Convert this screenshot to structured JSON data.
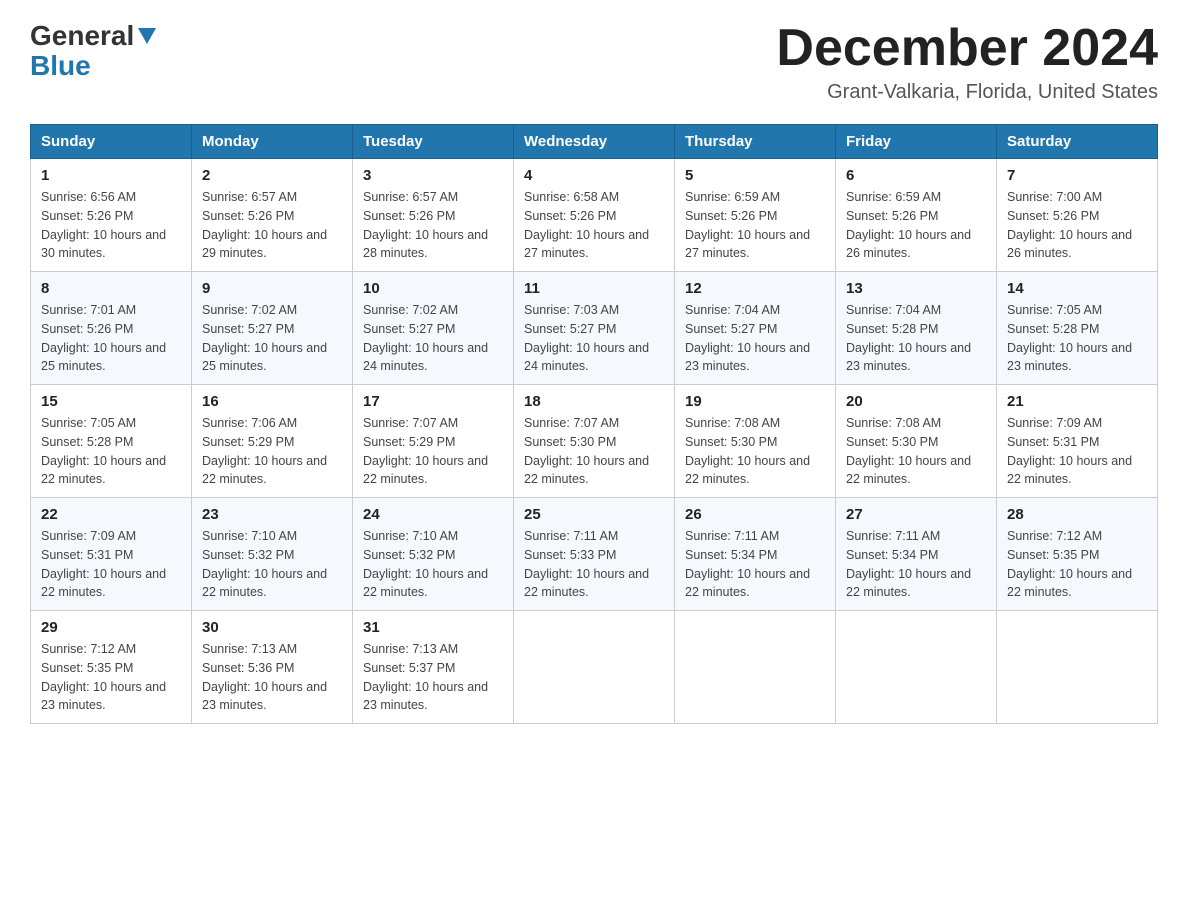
{
  "header": {
    "logo_general": "General",
    "logo_blue": "Blue",
    "month_year": "December 2024",
    "location": "Grant-Valkaria, Florida, United States"
  },
  "days_of_week": [
    "Sunday",
    "Monday",
    "Tuesday",
    "Wednesday",
    "Thursday",
    "Friday",
    "Saturday"
  ],
  "weeks": [
    [
      {
        "day": "1",
        "sunrise": "Sunrise: 6:56 AM",
        "sunset": "Sunset: 5:26 PM",
        "daylight": "Daylight: 10 hours and 30 minutes."
      },
      {
        "day": "2",
        "sunrise": "Sunrise: 6:57 AM",
        "sunset": "Sunset: 5:26 PM",
        "daylight": "Daylight: 10 hours and 29 minutes."
      },
      {
        "day": "3",
        "sunrise": "Sunrise: 6:57 AM",
        "sunset": "Sunset: 5:26 PM",
        "daylight": "Daylight: 10 hours and 28 minutes."
      },
      {
        "day": "4",
        "sunrise": "Sunrise: 6:58 AM",
        "sunset": "Sunset: 5:26 PM",
        "daylight": "Daylight: 10 hours and 27 minutes."
      },
      {
        "day": "5",
        "sunrise": "Sunrise: 6:59 AM",
        "sunset": "Sunset: 5:26 PM",
        "daylight": "Daylight: 10 hours and 27 minutes."
      },
      {
        "day": "6",
        "sunrise": "Sunrise: 6:59 AM",
        "sunset": "Sunset: 5:26 PM",
        "daylight": "Daylight: 10 hours and 26 minutes."
      },
      {
        "day": "7",
        "sunrise": "Sunrise: 7:00 AM",
        "sunset": "Sunset: 5:26 PM",
        "daylight": "Daylight: 10 hours and 26 minutes."
      }
    ],
    [
      {
        "day": "8",
        "sunrise": "Sunrise: 7:01 AM",
        "sunset": "Sunset: 5:26 PM",
        "daylight": "Daylight: 10 hours and 25 minutes."
      },
      {
        "day": "9",
        "sunrise": "Sunrise: 7:02 AM",
        "sunset": "Sunset: 5:27 PM",
        "daylight": "Daylight: 10 hours and 25 minutes."
      },
      {
        "day": "10",
        "sunrise": "Sunrise: 7:02 AM",
        "sunset": "Sunset: 5:27 PM",
        "daylight": "Daylight: 10 hours and 24 minutes."
      },
      {
        "day": "11",
        "sunrise": "Sunrise: 7:03 AM",
        "sunset": "Sunset: 5:27 PM",
        "daylight": "Daylight: 10 hours and 24 minutes."
      },
      {
        "day": "12",
        "sunrise": "Sunrise: 7:04 AM",
        "sunset": "Sunset: 5:27 PM",
        "daylight": "Daylight: 10 hours and 23 minutes."
      },
      {
        "day": "13",
        "sunrise": "Sunrise: 7:04 AM",
        "sunset": "Sunset: 5:28 PM",
        "daylight": "Daylight: 10 hours and 23 minutes."
      },
      {
        "day": "14",
        "sunrise": "Sunrise: 7:05 AM",
        "sunset": "Sunset: 5:28 PM",
        "daylight": "Daylight: 10 hours and 23 minutes."
      }
    ],
    [
      {
        "day": "15",
        "sunrise": "Sunrise: 7:05 AM",
        "sunset": "Sunset: 5:28 PM",
        "daylight": "Daylight: 10 hours and 22 minutes."
      },
      {
        "day": "16",
        "sunrise": "Sunrise: 7:06 AM",
        "sunset": "Sunset: 5:29 PM",
        "daylight": "Daylight: 10 hours and 22 minutes."
      },
      {
        "day": "17",
        "sunrise": "Sunrise: 7:07 AM",
        "sunset": "Sunset: 5:29 PM",
        "daylight": "Daylight: 10 hours and 22 minutes."
      },
      {
        "day": "18",
        "sunrise": "Sunrise: 7:07 AM",
        "sunset": "Sunset: 5:30 PM",
        "daylight": "Daylight: 10 hours and 22 minutes."
      },
      {
        "day": "19",
        "sunrise": "Sunrise: 7:08 AM",
        "sunset": "Sunset: 5:30 PM",
        "daylight": "Daylight: 10 hours and 22 minutes."
      },
      {
        "day": "20",
        "sunrise": "Sunrise: 7:08 AM",
        "sunset": "Sunset: 5:30 PM",
        "daylight": "Daylight: 10 hours and 22 minutes."
      },
      {
        "day": "21",
        "sunrise": "Sunrise: 7:09 AM",
        "sunset": "Sunset: 5:31 PM",
        "daylight": "Daylight: 10 hours and 22 minutes."
      }
    ],
    [
      {
        "day": "22",
        "sunrise": "Sunrise: 7:09 AM",
        "sunset": "Sunset: 5:31 PM",
        "daylight": "Daylight: 10 hours and 22 minutes."
      },
      {
        "day": "23",
        "sunrise": "Sunrise: 7:10 AM",
        "sunset": "Sunset: 5:32 PM",
        "daylight": "Daylight: 10 hours and 22 minutes."
      },
      {
        "day": "24",
        "sunrise": "Sunrise: 7:10 AM",
        "sunset": "Sunset: 5:32 PM",
        "daylight": "Daylight: 10 hours and 22 minutes."
      },
      {
        "day": "25",
        "sunrise": "Sunrise: 7:11 AM",
        "sunset": "Sunset: 5:33 PM",
        "daylight": "Daylight: 10 hours and 22 minutes."
      },
      {
        "day": "26",
        "sunrise": "Sunrise: 7:11 AM",
        "sunset": "Sunset: 5:34 PM",
        "daylight": "Daylight: 10 hours and 22 minutes."
      },
      {
        "day": "27",
        "sunrise": "Sunrise: 7:11 AM",
        "sunset": "Sunset: 5:34 PM",
        "daylight": "Daylight: 10 hours and 22 minutes."
      },
      {
        "day": "28",
        "sunrise": "Sunrise: 7:12 AM",
        "sunset": "Sunset: 5:35 PM",
        "daylight": "Daylight: 10 hours and 22 minutes."
      }
    ],
    [
      {
        "day": "29",
        "sunrise": "Sunrise: 7:12 AM",
        "sunset": "Sunset: 5:35 PM",
        "daylight": "Daylight: 10 hours and 23 minutes."
      },
      {
        "day": "30",
        "sunrise": "Sunrise: 7:13 AM",
        "sunset": "Sunset: 5:36 PM",
        "daylight": "Daylight: 10 hours and 23 minutes."
      },
      {
        "day": "31",
        "sunrise": "Sunrise: 7:13 AM",
        "sunset": "Sunset: 5:37 PM",
        "daylight": "Daylight: 10 hours and 23 minutes."
      },
      null,
      null,
      null,
      null
    ]
  ]
}
